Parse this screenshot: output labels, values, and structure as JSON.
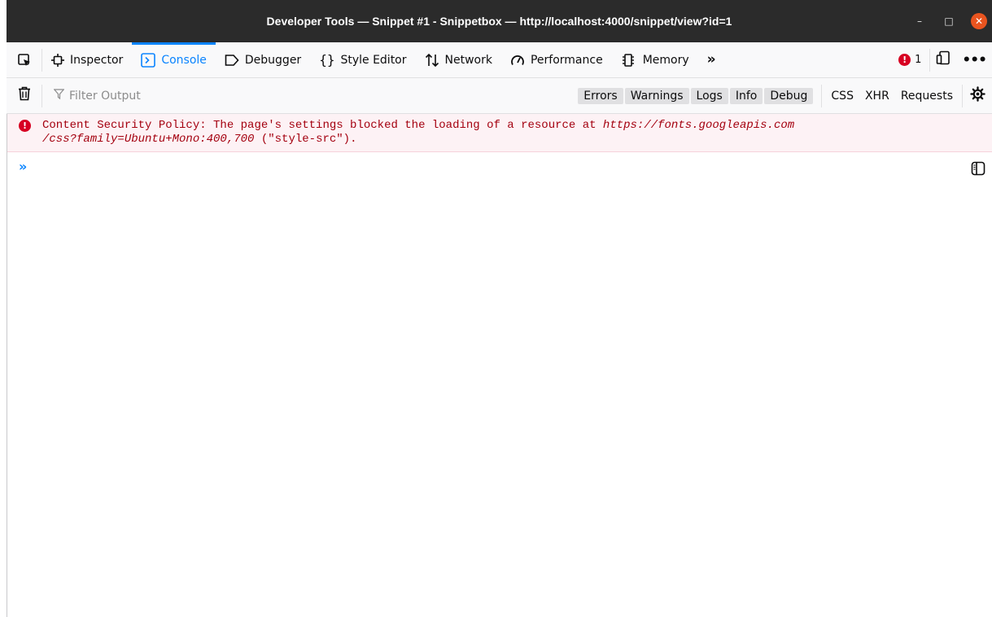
{
  "window": {
    "title": "Developer Tools — Snippet #1 - Snippetbox — http://localhost:4000/snippet/view?id=1",
    "minimize": "–",
    "maximize": "□",
    "close": "✕"
  },
  "toolbar": {
    "tabs": [
      {
        "label": "Inspector",
        "icon": "inspector-icon"
      },
      {
        "label": "Console",
        "icon": "console-icon",
        "active": true
      },
      {
        "label": "Debugger",
        "icon": "debugger-icon"
      },
      {
        "label": "Style Editor",
        "icon": "style-editor-icon"
      },
      {
        "label": "Network",
        "icon": "network-icon"
      },
      {
        "label": "Performance",
        "icon": "performance-icon"
      },
      {
        "label": "Memory",
        "icon": "memory-icon"
      }
    ],
    "error_count": "1"
  },
  "filterbar": {
    "placeholder": "Filter Output",
    "levels": [
      "Errors",
      "Warnings",
      "Logs",
      "Info",
      "Debug"
    ],
    "types": [
      "CSS",
      "XHR",
      "Requests"
    ]
  },
  "messages": [
    {
      "level": "error",
      "text": "Content Security Policy: The page's settings blocked the loading of a resource at ",
      "url_line1": "https://fonts.googleapis.com",
      "url_line2": "/css?family=Ubuntu+Mono:400,700",
      "suffix": " (\"style-src\")."
    }
  ],
  "colors": {
    "accent": "#0a84ff",
    "error": "#d70022",
    "error_text": "#a4000f",
    "error_bg": "#fdf2f5"
  }
}
